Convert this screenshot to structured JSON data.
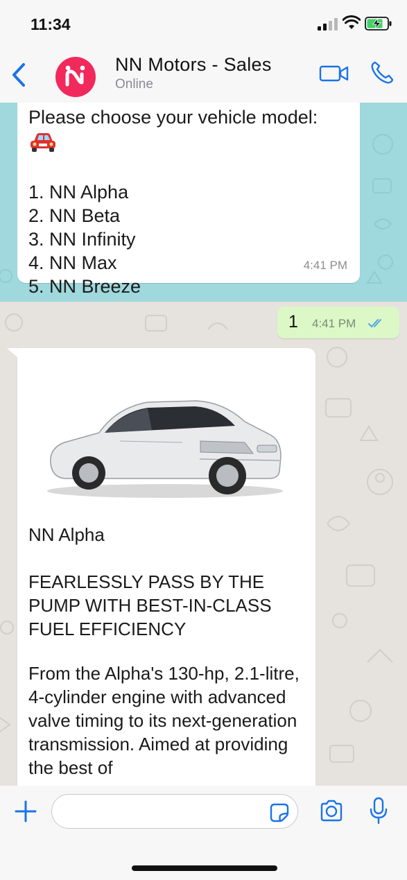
{
  "status_bar": {
    "time": "11:34"
  },
  "header": {
    "title": "NN Motors - Sales",
    "status": "Online",
    "avatar_letter": "N",
    "brand_color": "#f2295b",
    "icons": [
      "chevron-left-icon",
      "video-icon",
      "phone-icon"
    ]
  },
  "messages": {
    "menu": {
      "prompt": "Please choose your vehicle model:",
      "emoji": "red-car-emoji",
      "options": [
        "1. NN Alpha",
        "2. NN Beta",
        "3. NN Infinity",
        "4. NN Max",
        "5. NN Breeze"
      ],
      "time": "4:41 PM"
    },
    "reply": {
      "text": "1",
      "time": "4:41 PM",
      "status": "read"
    },
    "detail": {
      "name": "NN Alpha",
      "headline": "FEARLESSLY PASS BY THE PUMP WITH BEST-IN-CLASS FUEL EFFICIENCY",
      "body": "From the Alpha's 130-hp, 2.1-litre, 4-cylinder engine with advanced valve timing to its next-generation transmission. Aimed at providing the best of"
    }
  },
  "input": {
    "value": "",
    "icons": [
      "plus-icon",
      "sticker-icon",
      "camera-icon",
      "mic-icon"
    ]
  },
  "colors": {
    "accent": "#1a73e8",
    "outgoing_bubble": "#dcf8c6",
    "chat_bg_top": "#9fd8dd",
    "chat_bg": "#e6e2de"
  }
}
